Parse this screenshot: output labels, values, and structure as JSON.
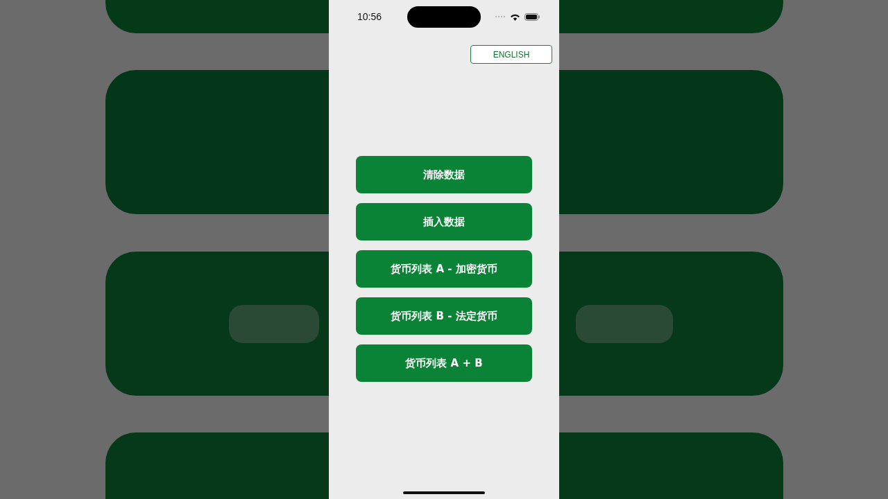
{
  "status_bar": {
    "time": "10:56"
  },
  "language_button": {
    "label": "ENGLISH"
  },
  "buttons": [
    {
      "label": "清除数据"
    },
    {
      "label": "插入数据"
    },
    {
      "label": "货币列表 A - 加密货币"
    },
    {
      "label": "货币列表 B - 法定货币"
    },
    {
      "label": "货币列表 A + B"
    }
  ]
}
